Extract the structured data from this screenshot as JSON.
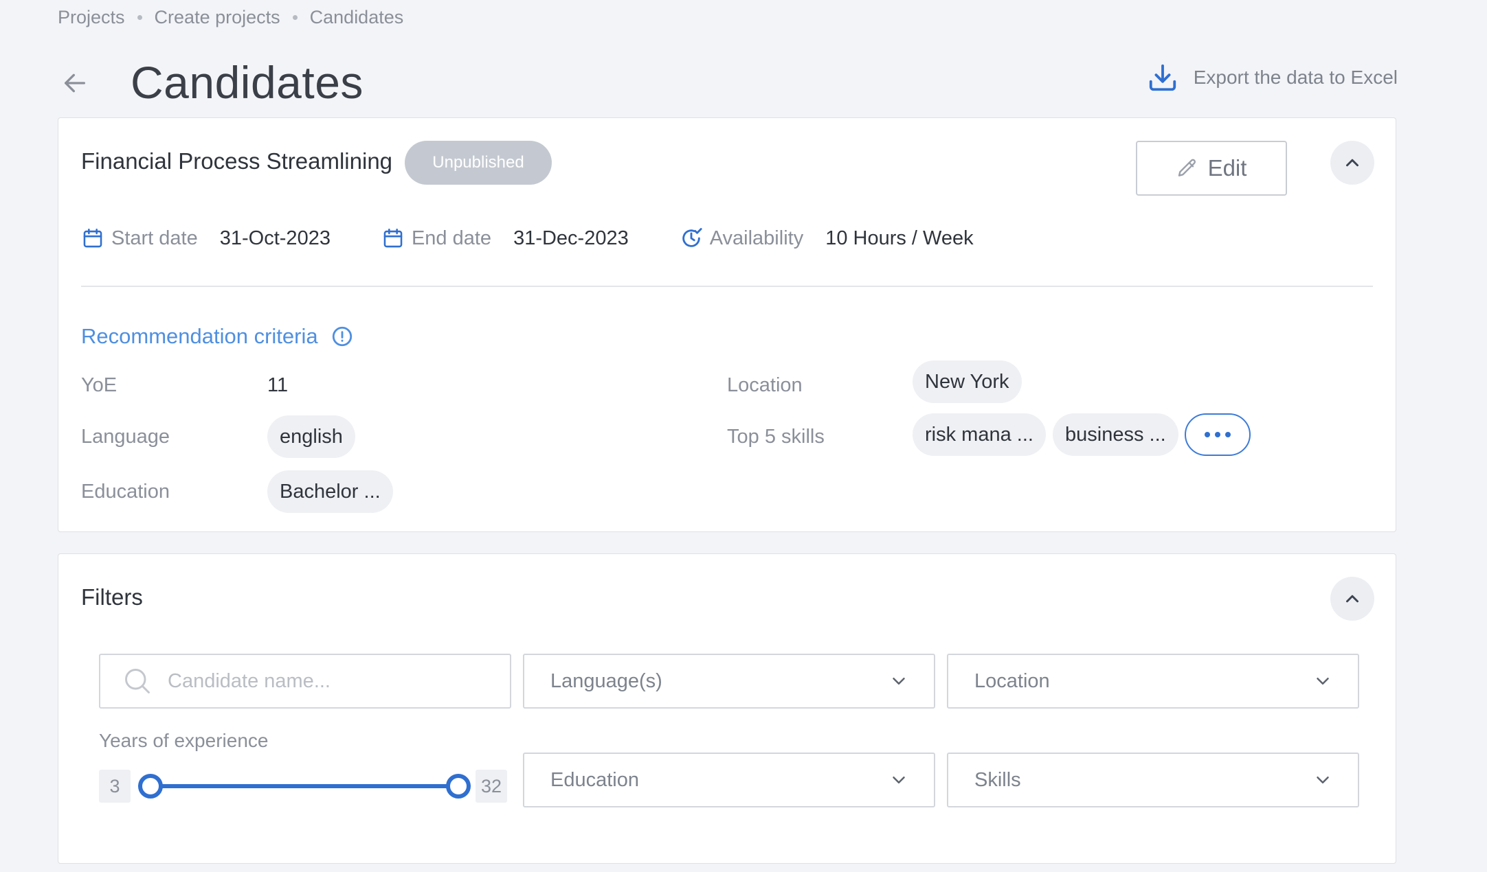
{
  "breadcrumb": [
    "Projects",
    "Create projects",
    "Candidates"
  ],
  "header": {
    "title": "Candidates",
    "export_label": "Export the data to Excel"
  },
  "project": {
    "name": "Financial Process Streamlining",
    "status": "Unpublished",
    "edit_label": "Edit",
    "start_date_label": "Start date",
    "start_date": "31-Oct-2023",
    "end_date_label": "End date",
    "end_date": "31-Dec-2023",
    "availability_label": "Availability",
    "availability": "10 Hours / Week"
  },
  "criteria": {
    "title": "Recommendation criteria",
    "yoe_label": "YoE",
    "yoe": "11",
    "language_label": "Language",
    "language": "english",
    "education_label": "Education",
    "education": "Bachelor ...",
    "location_label": "Location",
    "location": "New York",
    "skills_label": "Top 5 skills",
    "skills": [
      "risk mana ...",
      "business ..."
    ]
  },
  "filters": {
    "title": "Filters",
    "search_placeholder": "Candidate name...",
    "language_select": "Language(s)",
    "location_select": "Location",
    "education_select": "Education",
    "skills_select": "Skills",
    "yoe_label": "Years of experience",
    "yoe_min": "3",
    "yoe_max": "32"
  },
  "colors": {
    "accent": "#2f6fd0",
    "link": "#4f8fe0",
    "badge": "#c4c9d1",
    "background": "#f3f4f7"
  },
  "icons": {
    "back": "arrow-left-icon",
    "export": "download-icon",
    "edit": "pencil-icon",
    "collapse": "chevron-up-icon",
    "calendar": "calendar-icon",
    "availability": "clock-check-icon",
    "info": "info-icon",
    "search": "search-icon",
    "dropdown": "chevron-down-icon",
    "more": "more-horizontal-icon"
  }
}
